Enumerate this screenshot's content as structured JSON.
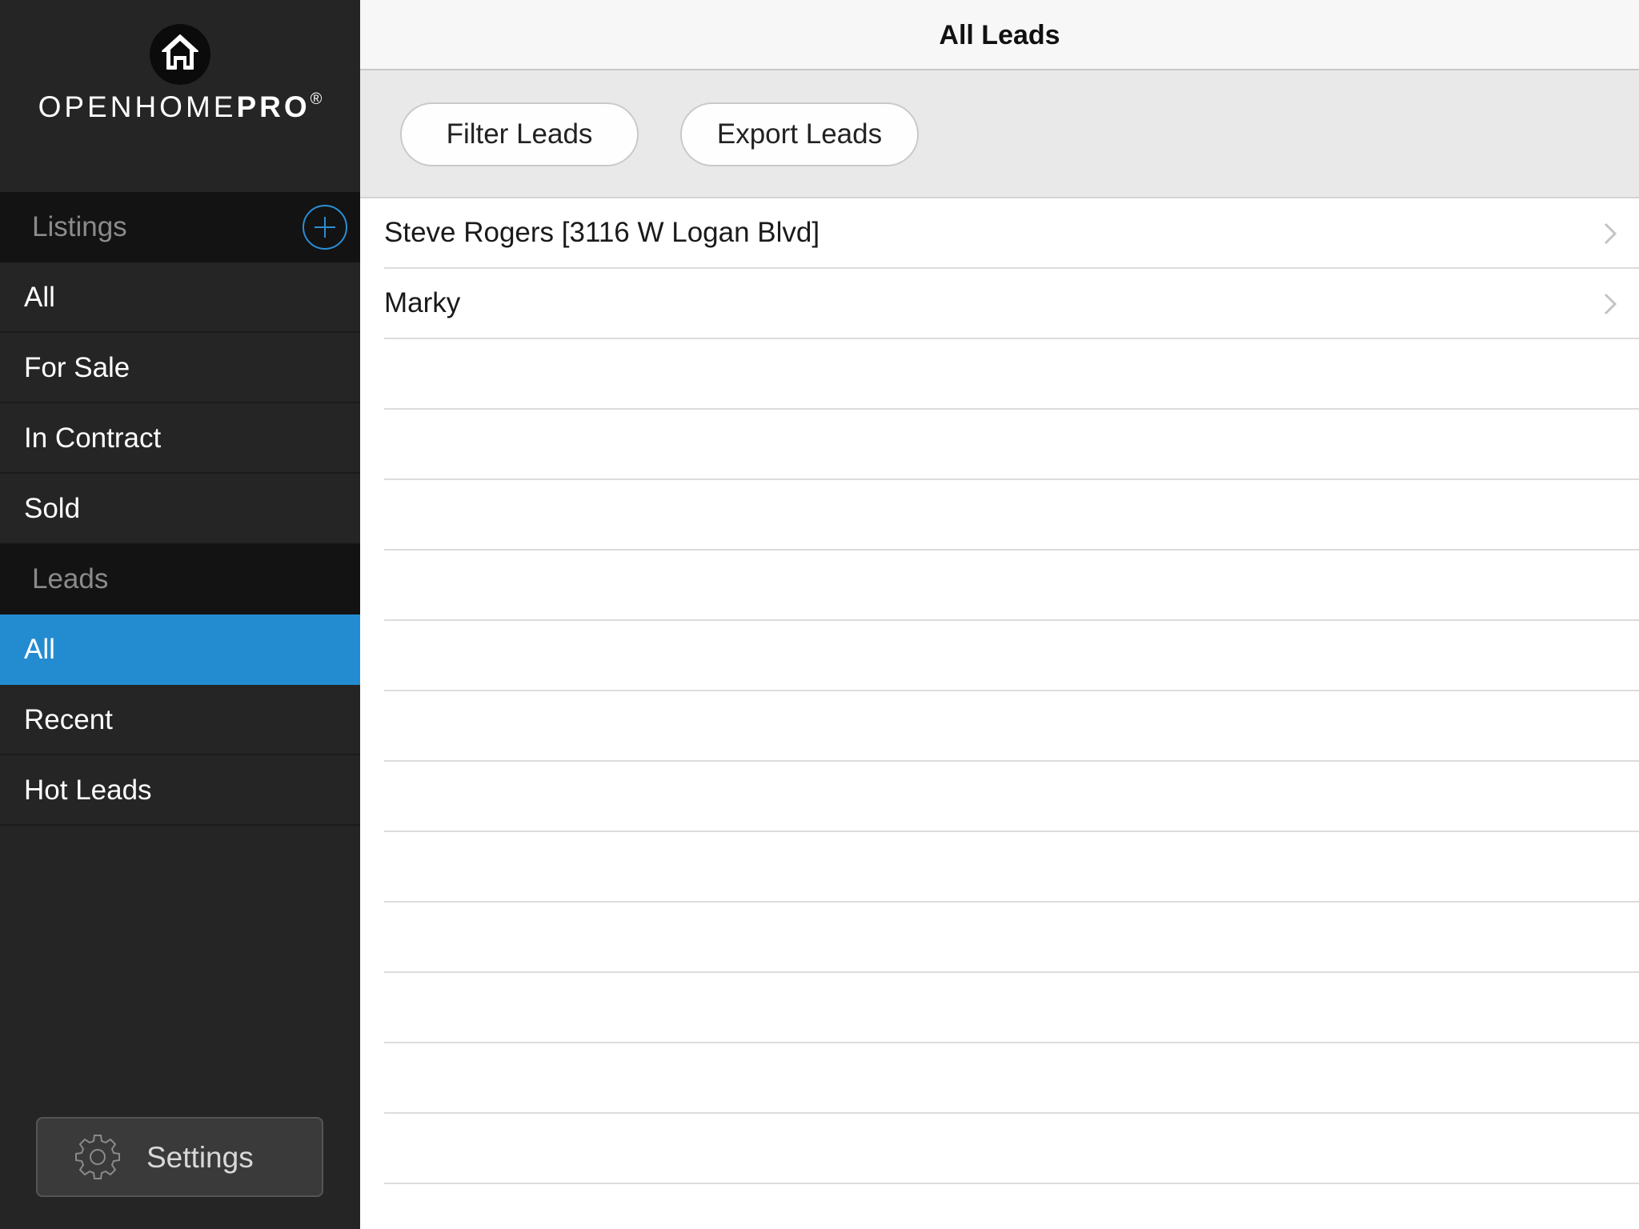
{
  "brand": {
    "name_light": "OPENHOME",
    "name_bold": "PRO",
    "registered": "®"
  },
  "sidebar": {
    "listings_header": "Listings",
    "listings_items": [
      "All",
      "For Sale",
      "In Contract",
      "Sold"
    ],
    "leads_header": "Leads",
    "leads_items": [
      "All",
      "Recent",
      "Hot Leads"
    ],
    "active_item": "leads.All",
    "settings_label": "Settings"
  },
  "main": {
    "title": "All Leads",
    "filter_button": "Filter Leads",
    "export_button": "Export Leads",
    "leads": [
      "Steve Rogers [3116 W Logan Blvd]",
      "Marky"
    ]
  },
  "colors": {
    "accent": "#238cd1",
    "sidebar_bg": "#252525",
    "section_header_bg": "#131313"
  },
  "icons": [
    "house-icon",
    "plus-circle-icon",
    "gear-icon",
    "chevron-right-icon"
  ]
}
